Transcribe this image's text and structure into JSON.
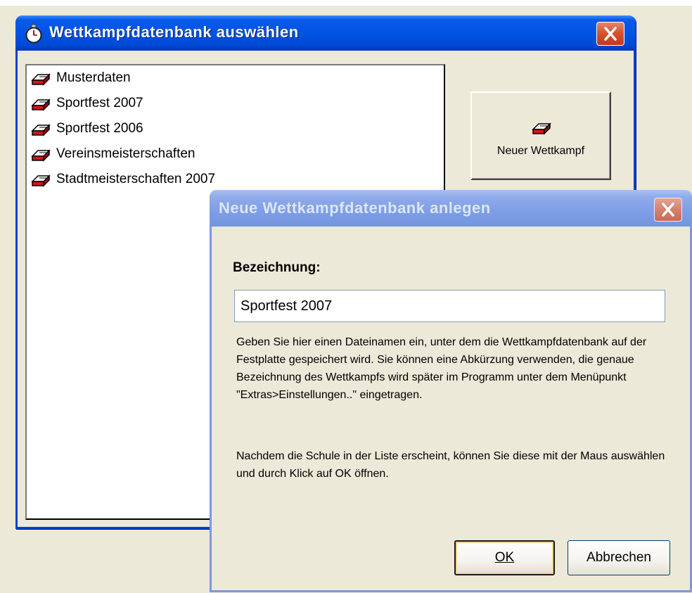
{
  "main_window": {
    "title": "Wettkampfdatenbank auswählen",
    "app_icon": "stopwatch-icon",
    "close_icon": "close-icon",
    "list_items": [
      {
        "label": "Musterdaten",
        "icon": "database-icon"
      },
      {
        "label": "Sportfest 2007",
        "icon": "database-icon"
      },
      {
        "label": "Sportfest 2006",
        "icon": "database-icon"
      },
      {
        "label": "Vereinsmeisterschaften",
        "icon": "database-icon"
      },
      {
        "label": "Stadtmeisterschaften 2007",
        "icon": "database-icon"
      }
    ],
    "new_button_label": "Neuer Wettkampf"
  },
  "dialog": {
    "title": "Neue Wettkampfdatenbank anlegen",
    "field_label": "Bezeichnung:",
    "field_value": "Sportfest 2007",
    "help_text_1": "Geben Sie hier einen Dateinamen ein, unter dem die Wettkampfdatenbank auf der Festplatte gespeichert wird. Sie können eine Abkürzung verwenden, die genaue Bezeichnung des Wettkampfs wird später im Programm unter dem Menüpunkt \"Extras>Einstellungen..\" eingetragen.",
    "help_text_2": "Nachdem die Schule in der Liste erscheint, können Sie diese mit der Maus auswählen und durch Klick auf OK öffnen.",
    "ok_label": "OK",
    "cancel_label": "Abbrechen"
  },
  "colors": {
    "active_titlebar": "#0054e3",
    "inactive_titlebar": "#7f9fe6",
    "window_background": "#ece9d8",
    "close_button": "#d9532e"
  }
}
